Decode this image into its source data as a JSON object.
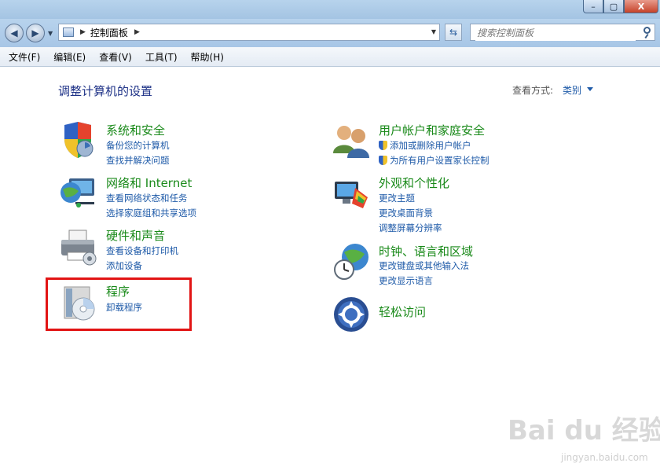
{
  "window": {
    "controls": {
      "minimize": "–",
      "maximize": "▢",
      "close": "X"
    }
  },
  "nav": {
    "back_icon": "back-arrow-icon",
    "forward_icon": "forward-arrow-icon",
    "address": {
      "path": "控制面板",
      "separator": "▶"
    },
    "search_placeholder": "搜索控制面板"
  },
  "menubar": {
    "items": [
      "文件(F)",
      "编辑(E)",
      "查看(V)",
      "工具(T)",
      "帮助(H)"
    ]
  },
  "content": {
    "title": "调整计算机的设置",
    "view_by_label": "查看方式:",
    "view_by_value": "类别"
  },
  "categories": [
    {
      "title": "系统和安全",
      "links": [
        "备份您的计算机",
        "查找并解决问题"
      ],
      "icon": "shield-icon"
    },
    {
      "title": "网络和 Internet",
      "links": [
        "查看网络状态和任务",
        "选择家庭组和共享选项"
      ],
      "icon": "network-globe-icon"
    },
    {
      "title": "硬件和声音",
      "links": [
        "查看设备和打印机",
        "添加设备"
      ],
      "icon": "printer-icon"
    },
    {
      "title": "程序",
      "links": [
        "卸载程序"
      ],
      "icon": "programs-disc-icon"
    },
    {
      "title": "用户帐户和家庭安全",
      "links": [
        "添加或删除用户帐户",
        "为所有用户设置家长控制"
      ],
      "icon": "users-icon"
    },
    {
      "title": "外观和个性化",
      "links": [
        "更改主题",
        "更改桌面背景",
        "调整屏幕分辨率"
      ],
      "icon": "monitor-palette-icon"
    },
    {
      "title": "时钟、语言和区域",
      "links": [
        "更改键盘或其他输入法",
        "更改显示语言"
      ],
      "icon": "clock-globe-icon"
    },
    {
      "title": "轻松访问",
      "links": [],
      "icon": "ease-of-access-icon"
    }
  ],
  "colors": {
    "category_title": "#1a8a1a",
    "link": "#1e5aa8",
    "highlight": "#e21414"
  },
  "watermark": {
    "text": "Bai du 经验",
    "sub": "jingyan.baidu.com"
  }
}
